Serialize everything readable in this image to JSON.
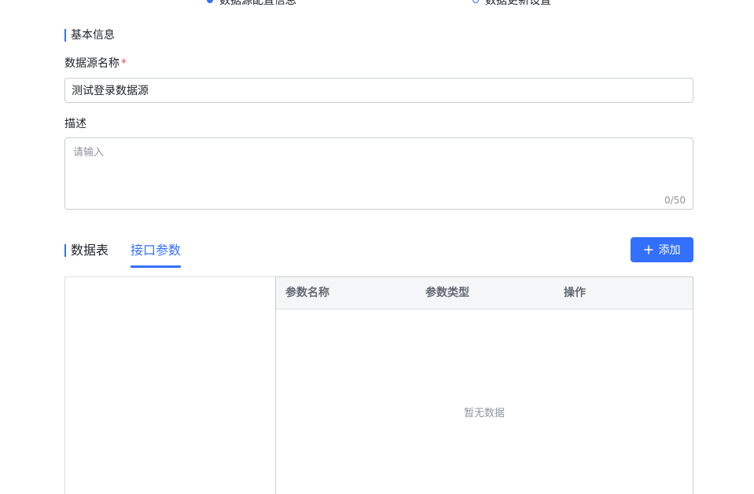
{
  "steps": [
    {
      "label": "数据源配置信息",
      "active": true
    },
    {
      "label": "数据更新设置",
      "active": false
    }
  ],
  "basic_info": {
    "section_title": "基本信息",
    "name_label": "数据源名称",
    "required_mark": "*",
    "name_value": "测试登录数据源",
    "desc_label": "描述",
    "desc_placeholder": "请输入",
    "desc_counter": "0/50"
  },
  "tabs": [
    {
      "label": "数据表",
      "active": false
    },
    {
      "label": "接口参数",
      "active": true
    }
  ],
  "add_button_label": "添加",
  "params_table": {
    "columns": [
      "参数名称",
      "参数类型",
      "操作"
    ],
    "rows": [],
    "empty_text": "暂无数据"
  },
  "colors": {
    "accent": "#3370ff",
    "required": "#f54a45",
    "muted_text": "#8f959e",
    "header_bg": "#f5f6f7"
  },
  "icons": {
    "add": "plus-icon",
    "step_active": "step-dot-filled-icon",
    "step_inactive": "step-dot-outline-icon"
  }
}
